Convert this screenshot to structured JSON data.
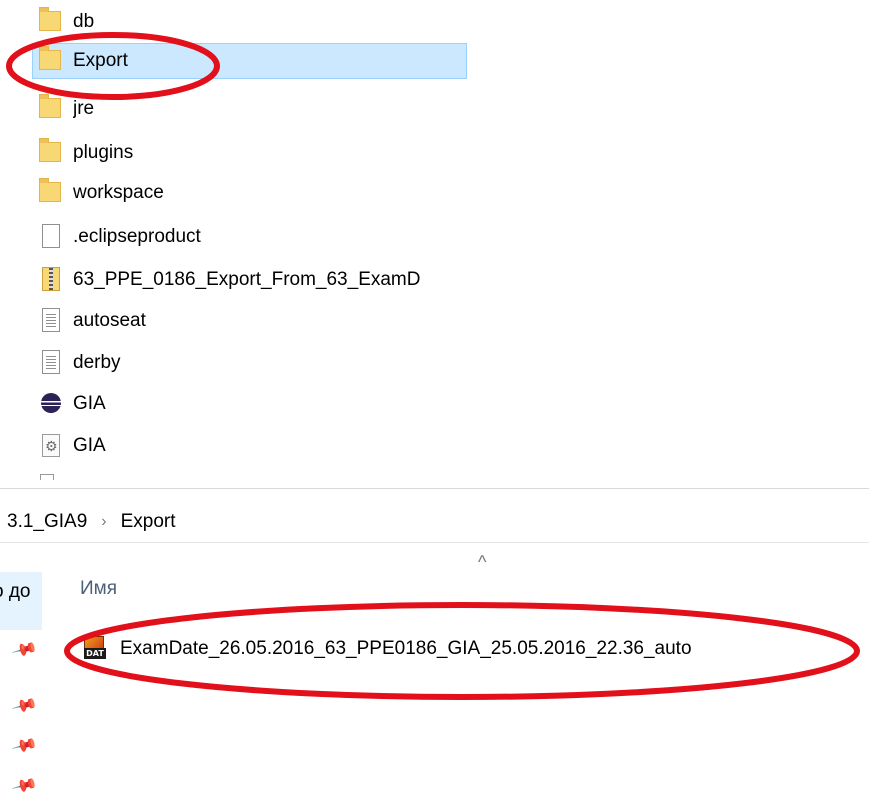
{
  "folder_list": {
    "items": [
      {
        "label": "db",
        "icon": "folder-icon"
      },
      {
        "label": "Export",
        "icon": "folder-icon",
        "selected": true
      },
      {
        "label": "jre",
        "icon": "folder-icon"
      },
      {
        "label": "plugins",
        "icon": "folder-icon"
      },
      {
        "label": "workspace",
        "icon": "folder-icon"
      },
      {
        "label": ".eclipseproduct",
        "icon": "blank-file-icon"
      },
      {
        "label": "63_PPE_0186_Export_From_63_ExamD",
        "icon": "zip-archive-icon"
      },
      {
        "label": "autoseat",
        "icon": "text-file-icon"
      },
      {
        "label": "derby",
        "icon": "text-file-icon"
      },
      {
        "label": "GIA",
        "icon": "eclipse-app-icon"
      },
      {
        "label": "GIA",
        "icon": "config-file-icon"
      }
    ]
  },
  "breadcrumb": {
    "parent": "3.1_GIA9",
    "separator": "›",
    "current": "Export"
  },
  "details": {
    "column_name": "Имя",
    "sort_indicator": "^",
    "quick_access_fragment": "о до",
    "files": [
      {
        "name": "ExamDate_26.05.2016_63_PPE0186_GIA_25.05.2016_22.36_auto",
        "icon": "dat-file-icon",
        "icon_tag": "DAT"
      }
    ]
  },
  "colors": {
    "selection_bg": "#cce8ff",
    "annotation_red": "#e2101a"
  }
}
